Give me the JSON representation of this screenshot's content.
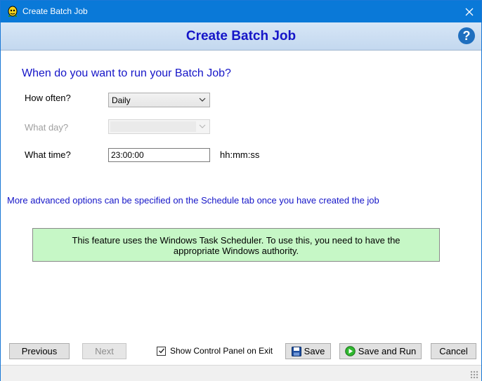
{
  "window": {
    "title": "Create Batch Job"
  },
  "header": {
    "heading": "Create Batch Job",
    "help_glyph": "?"
  },
  "form": {
    "question": "When do you want to run your Batch Job?",
    "how_often": {
      "label": "How often?",
      "value": "Daily"
    },
    "what_day": {
      "label": "What day?",
      "value": "",
      "disabled": true
    },
    "what_time": {
      "label": "What time?",
      "value": "23:00:00",
      "format_hint": "hh:mm:ss"
    }
  },
  "advanced_note": "More advanced options can be specified on the Schedule tab once you have created the job",
  "notice": {
    "line1": "This feature uses the Windows Task Scheduler. To use this, you need to have the",
    "line2": "appropriate Windows authority."
  },
  "footer": {
    "previous_label": "Previous",
    "next_label": "Next",
    "show_control_panel_label": "Show Control Panel on Exit",
    "show_control_panel_checked": true,
    "save_label": "Save",
    "save_and_run_label": "Save and Run",
    "cancel_label": "Cancel"
  },
  "colors": {
    "titlebar": "#0a79d8",
    "heading": "#1515c8",
    "notice_bg": "#c6f7c6"
  },
  "icons": [
    "app-icon",
    "close-icon",
    "help-icon",
    "chevron-down-icon",
    "save-disk-icon",
    "play-icon",
    "checkmark-icon",
    "resize-grip-icon"
  ]
}
